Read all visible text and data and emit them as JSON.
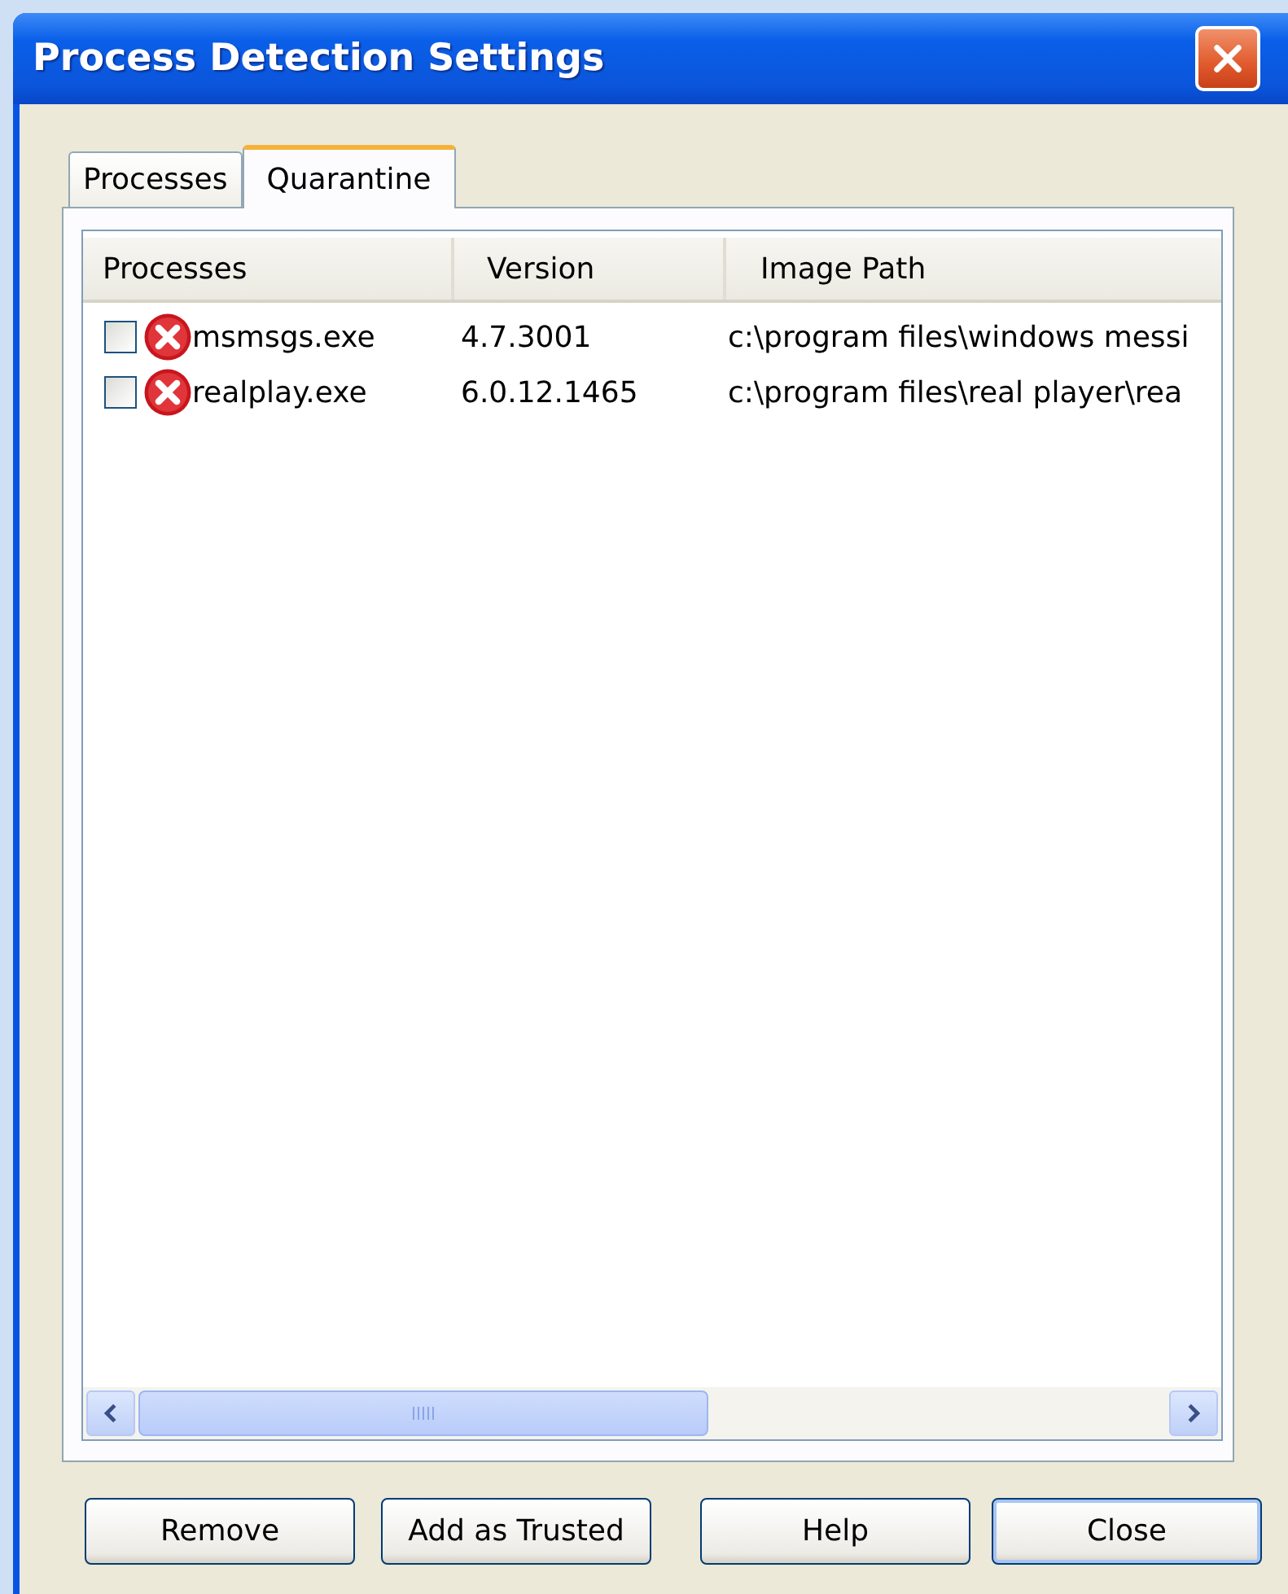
{
  "window": {
    "title": "Process Detection Settings"
  },
  "tabs": [
    {
      "label": "Processes",
      "selected": false
    },
    {
      "label": "Quarantine",
      "selected": true
    }
  ],
  "list": {
    "columns": [
      "Processes",
      "Version",
      "Image Path"
    ],
    "rows": [
      {
        "checked": false,
        "name": "msmsgs.exe",
        "version": "4.7.3001",
        "image_path": "c:\\program files\\windows messi"
      },
      {
        "checked": false,
        "name": "realplay.exe",
        "version": "6.0.12.1465",
        "image_path": "c:\\program files\\real player\\rea"
      }
    ]
  },
  "buttons": [
    {
      "label": "Remove",
      "default": false
    },
    {
      "label": "Add as Trusted",
      "default": false
    },
    {
      "label": "Help",
      "default": false
    },
    {
      "label": "Close",
      "default": true
    }
  ]
}
